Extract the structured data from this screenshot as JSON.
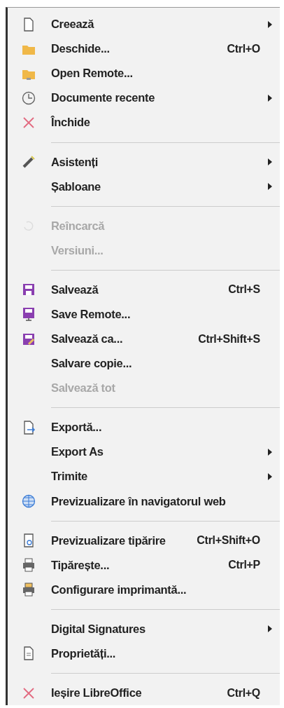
{
  "menu": {
    "groups": [
      {
        "items": [
          {
            "label": "Creează",
            "submenu": true,
            "disabled": false
          },
          {
            "label": "Deschide...",
            "shortcut": "Ctrl+O",
            "submenu": false,
            "disabled": false
          },
          {
            "label": "Open Remote...",
            "submenu": false,
            "disabled": false
          },
          {
            "label": "Documente recente",
            "submenu": true,
            "disabled": false
          },
          {
            "label": "Închide",
            "submenu": false,
            "disabled": false
          }
        ]
      },
      {
        "items": [
          {
            "label": "Asistenți",
            "submenu": true,
            "disabled": false
          },
          {
            "label": "Șabloane",
            "submenu": true,
            "disabled": false
          }
        ]
      },
      {
        "items": [
          {
            "label": "Reîncarcă",
            "submenu": false,
            "disabled": true
          },
          {
            "label": "Versiuni...",
            "submenu": false,
            "disabled": true
          }
        ]
      },
      {
        "items": [
          {
            "label": "Salvează",
            "shortcut": "Ctrl+S",
            "submenu": false,
            "disabled": false
          },
          {
            "label": "Save Remote...",
            "submenu": false,
            "disabled": false
          },
          {
            "label": "Salvează ca...",
            "shortcut": "Ctrl+Shift+S",
            "submenu": false,
            "disabled": false
          },
          {
            "label": "Salvare copie...",
            "submenu": false,
            "disabled": false
          },
          {
            "label": "Salvează tot",
            "submenu": false,
            "disabled": true
          }
        ]
      },
      {
        "items": [
          {
            "label": "Exportă...",
            "submenu": false,
            "disabled": false
          },
          {
            "label": "Export As",
            "submenu": true,
            "disabled": false
          },
          {
            "label": "Trimite",
            "submenu": true,
            "disabled": false
          },
          {
            "label": "Previzualizare în navigatorul web",
            "submenu": false,
            "disabled": false
          }
        ]
      },
      {
        "items": [
          {
            "label": "Previzualizare tipărire",
            "shortcut": "Ctrl+Shift+O",
            "submenu": false,
            "disabled": false
          },
          {
            "label": "Tipărește...",
            "shortcut": "Ctrl+P",
            "submenu": false,
            "disabled": false
          },
          {
            "label": "Configurare imprimantă...",
            "submenu": false,
            "disabled": false
          }
        ]
      },
      {
        "items": [
          {
            "label": "Digital Signatures",
            "submenu": true,
            "disabled": false
          },
          {
            "label": "Proprietăți...",
            "submenu": false,
            "disabled": false
          }
        ]
      },
      {
        "items": [
          {
            "label": "Ieșire LibreOffice",
            "shortcut": "Ctrl+Q",
            "submenu": false,
            "disabled": false
          }
        ]
      }
    ]
  }
}
